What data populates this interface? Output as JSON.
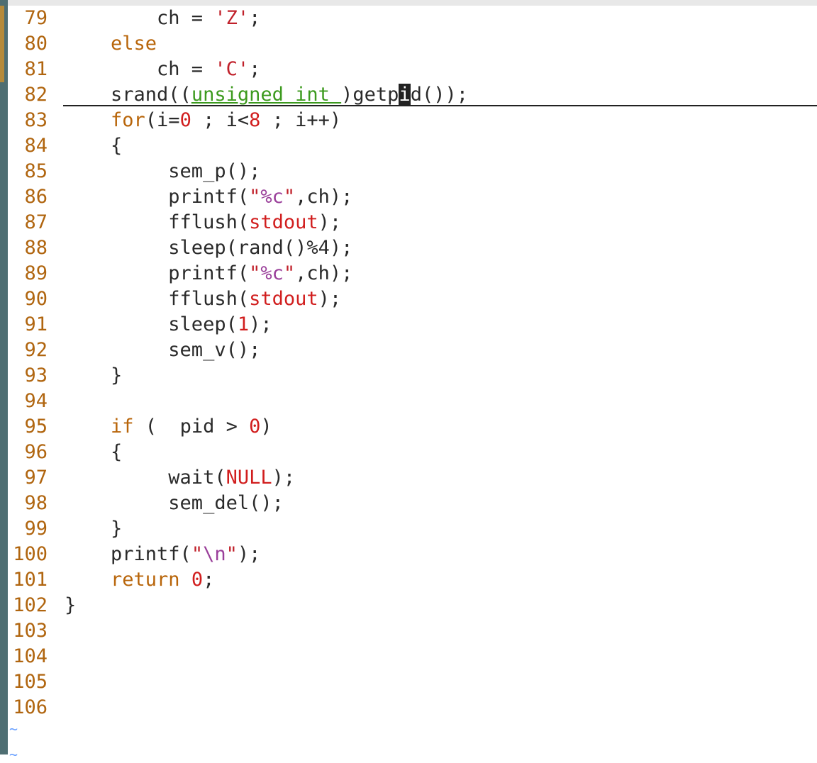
{
  "lines": [
    {
      "n": "79",
      "t": [
        [
          "",
          "        ch = "
        ],
        [
          "str",
          "'Z'"
        ],
        [
          "",
          ";"
        ]
      ]
    },
    {
      "n": "80",
      "t": [
        [
          "kw",
          "    else"
        ]
      ]
    },
    {
      "n": "81",
      "t": [
        [
          "",
          "        ch = "
        ],
        [
          "str",
          "'C'"
        ],
        [
          "",
          ";"
        ]
      ]
    },
    {
      "n": "82",
      "t": [
        [
          "",
          "    srand(("
        ],
        [
          "type",
          "unsigned int "
        ],
        [
          "",
          ")getp"
        ],
        [
          "cursor",
          "i"
        ],
        [
          "",
          "d());"
        ]
      ]
    },
    {
      "n": "83",
      "t": [
        [
          "kw",
          "    for"
        ],
        [
          "",
          "(i="
        ],
        [
          "num",
          "0"
        ],
        [
          "",
          " ; i<"
        ],
        [
          "num",
          "8"
        ],
        [
          "",
          " ; i++)"
        ]
      ]
    },
    {
      "n": "84",
      "t": [
        [
          "",
          "    {"
        ]
      ]
    },
    {
      "n": "85",
      "t": [
        [
          "",
          "         sem_p();"
        ]
      ]
    },
    {
      "n": "86",
      "t": [
        [
          "",
          "         printf("
        ],
        [
          "str",
          "\""
        ],
        [
          "fmt",
          "%c"
        ],
        [
          "str",
          "\""
        ],
        [
          "",
          ",ch);"
        ]
      ]
    },
    {
      "n": "87",
      "t": [
        [
          "",
          "         fflush("
        ],
        [
          "const",
          "stdout"
        ],
        [
          "",
          ");"
        ]
      ]
    },
    {
      "n": "88",
      "t": [
        [
          "",
          "         sleep(rand()%4);"
        ]
      ]
    },
    {
      "n": "89",
      "t": [
        [
          "",
          "         printf("
        ],
        [
          "str",
          "\""
        ],
        [
          "fmt",
          "%c"
        ],
        [
          "str",
          "\""
        ],
        [
          "",
          ",ch);"
        ]
      ]
    },
    {
      "n": "90",
      "t": [
        [
          "",
          "         fflush("
        ],
        [
          "const",
          "stdout"
        ],
        [
          "",
          ");"
        ]
      ]
    },
    {
      "n": "91",
      "t": [
        [
          "",
          "         sleep("
        ],
        [
          "num",
          "1"
        ],
        [
          "",
          ");"
        ]
      ]
    },
    {
      "n": "92",
      "t": [
        [
          "",
          "         sem_v();"
        ]
      ]
    },
    {
      "n": "93",
      "t": [
        [
          "",
          "    }"
        ]
      ]
    },
    {
      "n": "94",
      "t": []
    },
    {
      "n": "95",
      "t": [
        [
          "kw",
          "    if"
        ],
        [
          "",
          " (  pid > "
        ],
        [
          "num",
          "0"
        ],
        [
          "",
          ")"
        ]
      ]
    },
    {
      "n": "96",
      "t": [
        [
          "",
          "    {"
        ]
      ]
    },
    {
      "n": "97",
      "t": [
        [
          "",
          "         wait("
        ],
        [
          "const",
          "NULL"
        ],
        [
          "",
          ");"
        ]
      ]
    },
    {
      "n": "98",
      "t": [
        [
          "",
          "         sem_del();"
        ]
      ]
    },
    {
      "n": "99",
      "t": [
        [
          "",
          "    }"
        ]
      ]
    },
    {
      "n": "100",
      "t": [
        [
          "",
          "    printf("
        ],
        [
          "str",
          "\""
        ],
        [
          "fmt",
          "\\n"
        ],
        [
          "str",
          "\""
        ],
        [
          "",
          ");"
        ]
      ]
    },
    {
      "n": "101",
      "t": [
        [
          "kw",
          "    return"
        ],
        [
          "",
          " "
        ],
        [
          "num",
          "0"
        ],
        [
          "",
          ";"
        ]
      ]
    },
    {
      "n": "102",
      "t": [
        [
          "",
          "}"
        ]
      ]
    },
    {
      "n": "103",
      "t": []
    },
    {
      "n": "104",
      "t": []
    },
    {
      "n": "105",
      "t": []
    },
    {
      "n": "106",
      "t": []
    }
  ],
  "tildes": [
    "~",
    "~"
  ],
  "colors": {
    "line_number": "#b0650f",
    "keyword": "#b8650a",
    "type": "#3c9a1e",
    "number": "#d11e1e",
    "string": "#c0202a",
    "format": "#9a3f9a",
    "text": "#2a2a2a",
    "tilde": "#6aa0ff"
  }
}
